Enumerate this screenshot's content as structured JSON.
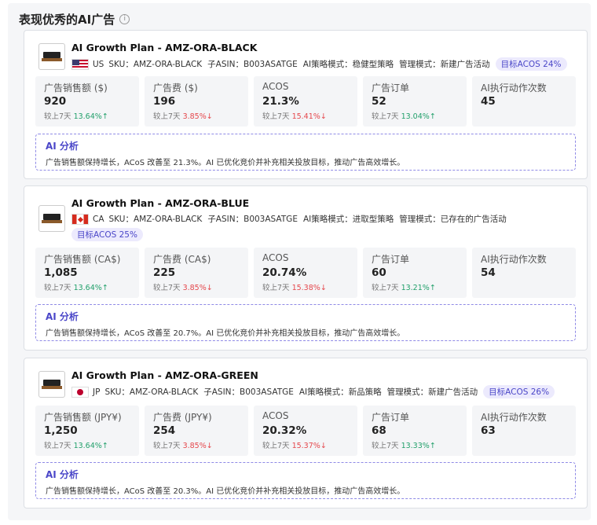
{
  "section_title": "表现优秀的AI广告",
  "info_icon": "info-icon",
  "cards": [
    {
      "title": "AI Growth Plan - AMZ-ORA-BLACK",
      "flag": "us-flag-icon",
      "country": "US",
      "sku": "SKU：AMZ-ORA-BLACK",
      "asin": "子ASIN：B003ASATGE",
      "strategy": "AI策略模式：稳健型策略",
      "manage": "管理模式：新建广告活动",
      "target": "目标ACOS 24%",
      "metrics": [
        {
          "label": "广告销售额 ($)",
          "value": "920",
          "prefix": "较上7天",
          "change": "13.64%",
          "arrow": "↑",
          "dir": "up"
        },
        {
          "label": "广告费 ($)",
          "value": "196",
          "prefix": "较上7天",
          "change": "3.85%",
          "arrow": "↓",
          "dir": "down"
        },
        {
          "label": "ACOS",
          "value": "21.3%",
          "prefix": "较上7天",
          "change": "15.41%",
          "arrow": "↓",
          "dir": "down"
        },
        {
          "label": "广告订单",
          "value": "52",
          "prefix": "较上7天",
          "change": "13.04%",
          "arrow": "↑",
          "dir": "up"
        },
        {
          "label": "AI执行动作次数",
          "value": "45",
          "prefix": "",
          "change": "",
          "arrow": "",
          "dir": ""
        }
      ],
      "analysis_title": "AI 分析",
      "analysis_text": "广告销售额保持增长，ACoS 改善至 21.3%。AI 已优化竞价并补充相关投放目标，推动广告高效增长。"
    },
    {
      "title": "AI Growth Plan - AMZ-ORA-BLUE",
      "flag": "ca-flag-icon",
      "country": "CA",
      "sku": "SKU：AMZ-ORA-BLACK",
      "asin": "子ASIN：B003ASATGE",
      "strategy": "AI策略模式：进取型策略",
      "manage": "管理模式：已存在的广告活动",
      "target": "目标ACOS 25%",
      "metrics": [
        {
          "label": "广告销售额 (CA$)",
          "value": "1,085",
          "prefix": "较上7天",
          "change": "13.64%",
          "arrow": "↑",
          "dir": "up"
        },
        {
          "label": "广告费 (CA$)",
          "value": "225",
          "prefix": "较上7天",
          "change": "3.85%",
          "arrow": "↓",
          "dir": "down"
        },
        {
          "label": "ACOS",
          "value": "20.74%",
          "prefix": "较上7天",
          "change": "15.38%",
          "arrow": "↓",
          "dir": "down"
        },
        {
          "label": "广告订单",
          "value": "60",
          "prefix": "较上7天",
          "change": "13.21%",
          "arrow": "↑",
          "dir": "up"
        },
        {
          "label": "AI执行动作次数",
          "value": "54",
          "prefix": "",
          "change": "",
          "arrow": "",
          "dir": ""
        }
      ],
      "analysis_title": "AI 分析",
      "analysis_text": "广告销售额保持增长，ACoS 改善至 20.7%。AI 已优化竞价并补充相关投放目标，推动广告高效增长。"
    },
    {
      "title": "AI Growth Plan - AMZ-ORA-GREEN",
      "flag": "jp-flag-icon",
      "country": "JP",
      "sku": "SKU：AMZ-ORA-BLACK",
      "asin": "子ASIN：B003ASATGE",
      "strategy": "AI策略模式：新品策略",
      "manage": "管理模式：新建广告活动",
      "target": "目标ACOS 26%",
      "metrics": [
        {
          "label": "广告销售额 (JPY¥)",
          "value": "1,250",
          "prefix": "较上7天",
          "change": "13.64%",
          "arrow": "↑",
          "dir": "up"
        },
        {
          "label": "广告费 (JPY¥)",
          "value": "254",
          "prefix": "较上7天",
          "change": "3.85%",
          "arrow": "↓",
          "dir": "down"
        },
        {
          "label": "ACOS",
          "value": "20.32%",
          "prefix": "较上7天",
          "change": "15.37%",
          "arrow": "↓",
          "dir": "down"
        },
        {
          "label": "广告订单",
          "value": "68",
          "prefix": "较上7天",
          "change": "13.33%",
          "arrow": "↑",
          "dir": "up"
        },
        {
          "label": "AI执行动作次数",
          "value": "63",
          "prefix": "",
          "change": "",
          "arrow": "",
          "dir": ""
        }
      ],
      "analysis_title": "AI 分析",
      "analysis_text": "广告销售额保持增长，ACoS 改善至 20.3%。AI 已优化竞价并补充相关投放目标，推动广告高效增长。"
    }
  ]
}
